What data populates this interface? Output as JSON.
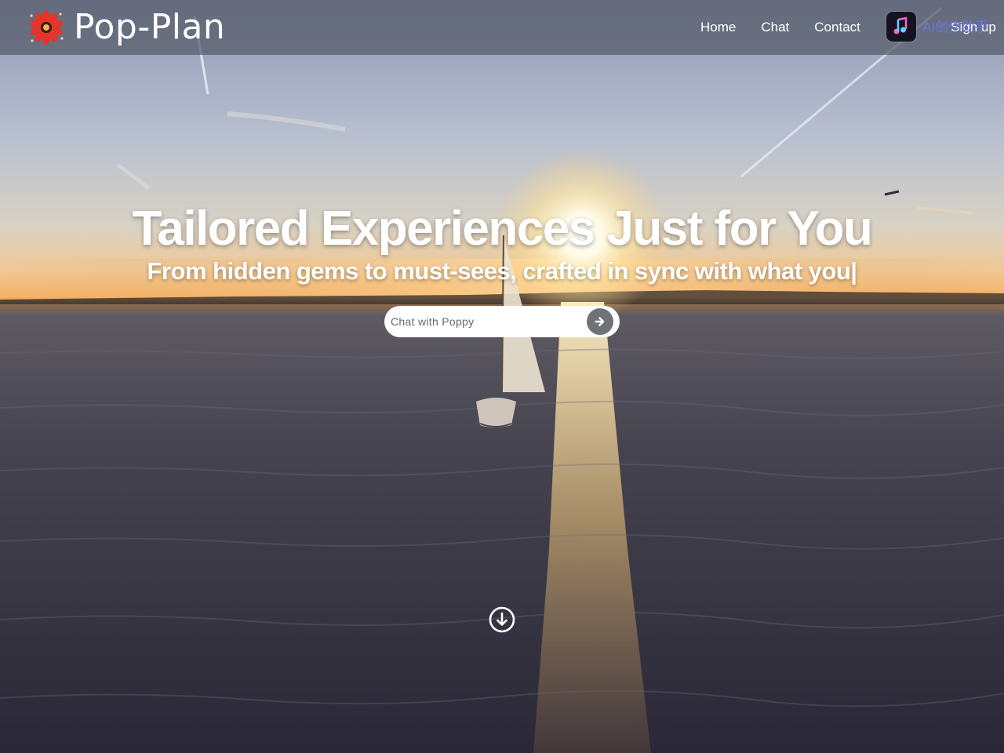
{
  "brand": {
    "name": "Pop-Plan",
    "logo_icon": "red-flower-icon"
  },
  "nav": {
    "items": [
      {
        "label": "Home"
      },
      {
        "label": "Chat"
      },
      {
        "label": "Contact"
      },
      {
        "label": "S"
      }
    ],
    "signup_label": "Sign up"
  },
  "overlay": {
    "badge_icon": "ai-creator-badge-icon",
    "text": "AI创作助手"
  },
  "hero": {
    "title": "Tailored Experiences Just for You",
    "subtitle": "From hidden gems to must-sees, crafted in sync with what you|",
    "background": "sunset-sailboat-scene"
  },
  "chat": {
    "placeholder": "Chat with Poppy",
    "send_icon": "arrow-right-icon"
  },
  "scroll": {
    "icon": "arrow-down-circle-icon"
  },
  "colors": {
    "navbar_bg": "#555a68",
    "send_button": "#6f7378",
    "text": "#ffffff"
  }
}
